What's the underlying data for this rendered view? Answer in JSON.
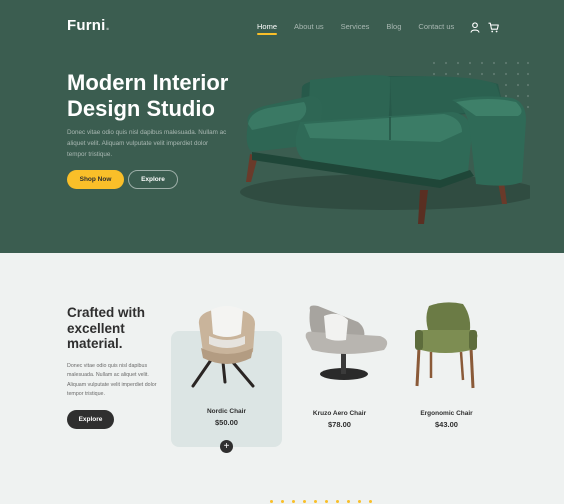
{
  "header": {
    "logo": "Furni",
    "logo_dot": ".",
    "nav": [
      "Home",
      "About us",
      "Services",
      "Blog",
      "Contact us"
    ],
    "active_nav": "Home",
    "icons": [
      "user-icon",
      "cart-icon"
    ]
  },
  "hero": {
    "title_line1": "Modern Interior",
    "title_line2": "Design Studio",
    "description": "Donec vitae odio quis nisl dapibus malesuada. Nullam ac aliquet velit. Aliquam vulputate velit imperdiet dolor tempor tristique.",
    "primary_button": "Shop Now",
    "secondary_button": "Explore"
  },
  "material": {
    "title_line1": "Crafted with",
    "title_line2": "excellent",
    "title_line3": "material.",
    "description": "Donec vitae odio quis nisl dapibus malesuada. Nullam ac aliquet velit. Aliquam vulputate velit imperdiet dolor tempor tristique.",
    "button": "Explore"
  },
  "products": [
    {
      "name": "Nordic Chair",
      "price": "$50.00"
    },
    {
      "name": "Kruzo Aero Chair",
      "price": "$78.00"
    },
    {
      "name": "Ergonomic Chair",
      "price": "$43.00"
    }
  ],
  "colors": {
    "hero_bg": "#3b5d50",
    "accent": "#f9bf29",
    "dark": "#2f2f2f",
    "page_bg": "#eff2f1",
    "card_bg": "#dce5e4"
  }
}
